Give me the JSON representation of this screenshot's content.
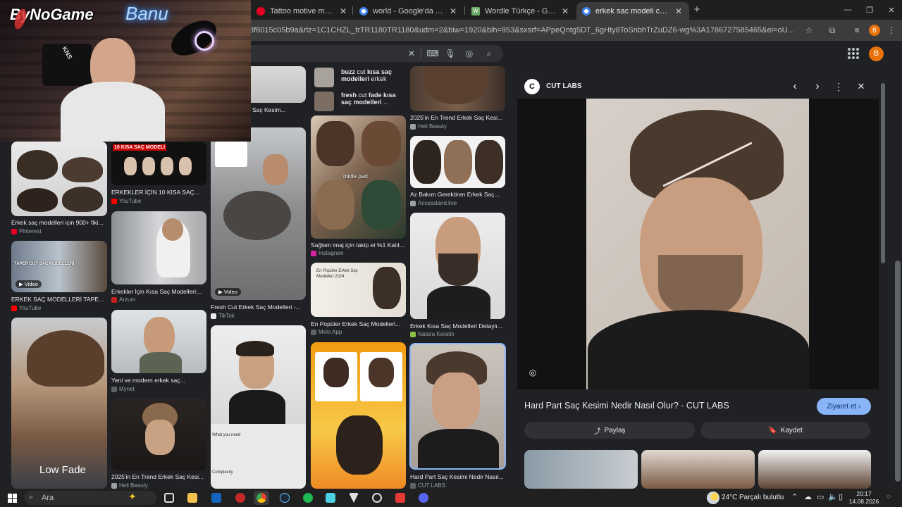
{
  "tabs": [
    {
      "title": "Tattoo motive männer panosundaki",
      "active": false,
      "color": "#e60023"
    },
    {
      "title": "world - Google'da Ara",
      "active": false,
      "color": "#4285f4"
    },
    {
      "title": "Wordle Türkçe - Günlük Kelime",
      "active": false,
      "color": "#6aaa64"
    },
    {
      "title": "erkek sac modeli cut - Google'da",
      "active": true,
      "color": "#4285f4"
    }
  ],
  "address": "8f8015c05b9a&rlz=1C1CHZL_trTR1180TR1180&udm=2&biw=1920&bih=953&sxsrf=APpeQntg5DT_6gHty8ToSnbhTrZuDZ6-wg%3A1786727585465&ei=oUx_arX6G7CWxc8Ph4WU2Qg&iv...",
  "profile_initial": "B",
  "webcam": {
    "logo": "ByNoGame",
    "neon": "Banu",
    "shirt": "KNS"
  },
  "related": [
    {
      "pre": "buzz",
      "mid": " cut ",
      "bold": "kısa saç modelleri",
      "post": " erkek"
    },
    {
      "pre": "fresh",
      "mid": " cut ",
      "bold": "fade kısa saç modelleri",
      "post": " ..."
    }
  ],
  "grid": {
    "col1": [
      {
        "title": "Erkek saç modelleri için 900+ fiki...",
        "source": "Pinterest",
        "src_color": "#e60023"
      },
      {
        "title": "ERKEK SAÇ MODELLERİ TAPER...",
        "source": "YouTube",
        "src_color": "#ff0000",
        "video": "Video",
        "overlay": "TAPER CUT SAÇ MODELLERİ"
      },
      {
        "title": "",
        "source": "",
        "overlay": "Low Fade"
      }
    ],
    "col2": [
      {
        "title": "ERKEKLER İÇİN 10 KISA SAÇ...",
        "source": "YouTube",
        "src_color": "#ff0000",
        "overlay": "10 KISA SAÇ MODELİ"
      },
      {
        "title": "Erkekler İçin Kısa Saç Modelleri:...",
        "source": "Arzum",
        "src_color": "#c5221f"
      },
      {
        "title": "Yeni ve modern erkek saç...",
        "source": "Mynet",
        "src_color": "#5f6368"
      },
      {
        "title": "2025'in En Trend Erkek Saç Kesi...",
        "source": "Heli Beauty",
        "src_color": "#9aa0a6"
      }
    ],
    "col3": [
      {
        "title": "Saç Kesim...",
        "source": ""
      },
      {
        "title": "Fresh Cut Erkek Saç Modelleri -...",
        "source": "TikTok",
        "src_color": "#e8eaed",
        "video": "Video"
      },
      {
        "title": "",
        "source": "",
        "caption_a": "What you need",
        "caption_b": "Complexity"
      }
    ],
    "col4": [
      {
        "title": "Sağlam imaj için takip et %1 Katıl...",
        "source": "Instagram",
        "src_color": "#d6249f",
        "overlay": "midle part"
      },
      {
        "title": "En Popüler Erkek Saç Modelleri...",
        "source": "Melo App",
        "src_color": "#5f6368",
        "overlay": "En Popüler Erkek Saç Modelleri 2024"
      },
      {
        "title": "",
        "source": ""
      }
    ],
    "col5": [
      {
        "title": "2025'in En Trend Erkek Saç Kesi...",
        "source": "Heli Beauty",
        "src_color": "#9aa0a6"
      },
      {
        "title": "Az Bakım Gerektiren Erkek Saç...",
        "source": "Accessland.live",
        "src_color": "#9aa0a6"
      },
      {
        "title": "Erkek Kısa Saç Modelleri Detaylı...",
        "source": "Natura Keratin",
        "src_color": "#8bc34a"
      },
      {
        "title": "Hard Part Saç Kesimi Nedir Nasıl...",
        "source": "CUT LABS",
        "src_color": "#5f6368"
      }
    ]
  },
  "panel": {
    "site": "CUT LABS",
    "logo_letter": "C",
    "title": "Hard Part Saç Kesimi Nedir Nasıl Olur? - CUT LABS",
    "visit": "Ziyaret et",
    "share": "Paylaş",
    "save": "Kaydet"
  },
  "taskbar": {
    "search": "Ara",
    "weather_temp": "24°C",
    "weather_desc": "Parçalı bulutlu",
    "time": "20:17",
    "date": "14.08.2026"
  },
  "colors": {
    "accent_blue": "#8ab4f8",
    "visit_bg": "#8ab4f8",
    "pill_bg": "#303134",
    "profile": "#e8710a"
  }
}
